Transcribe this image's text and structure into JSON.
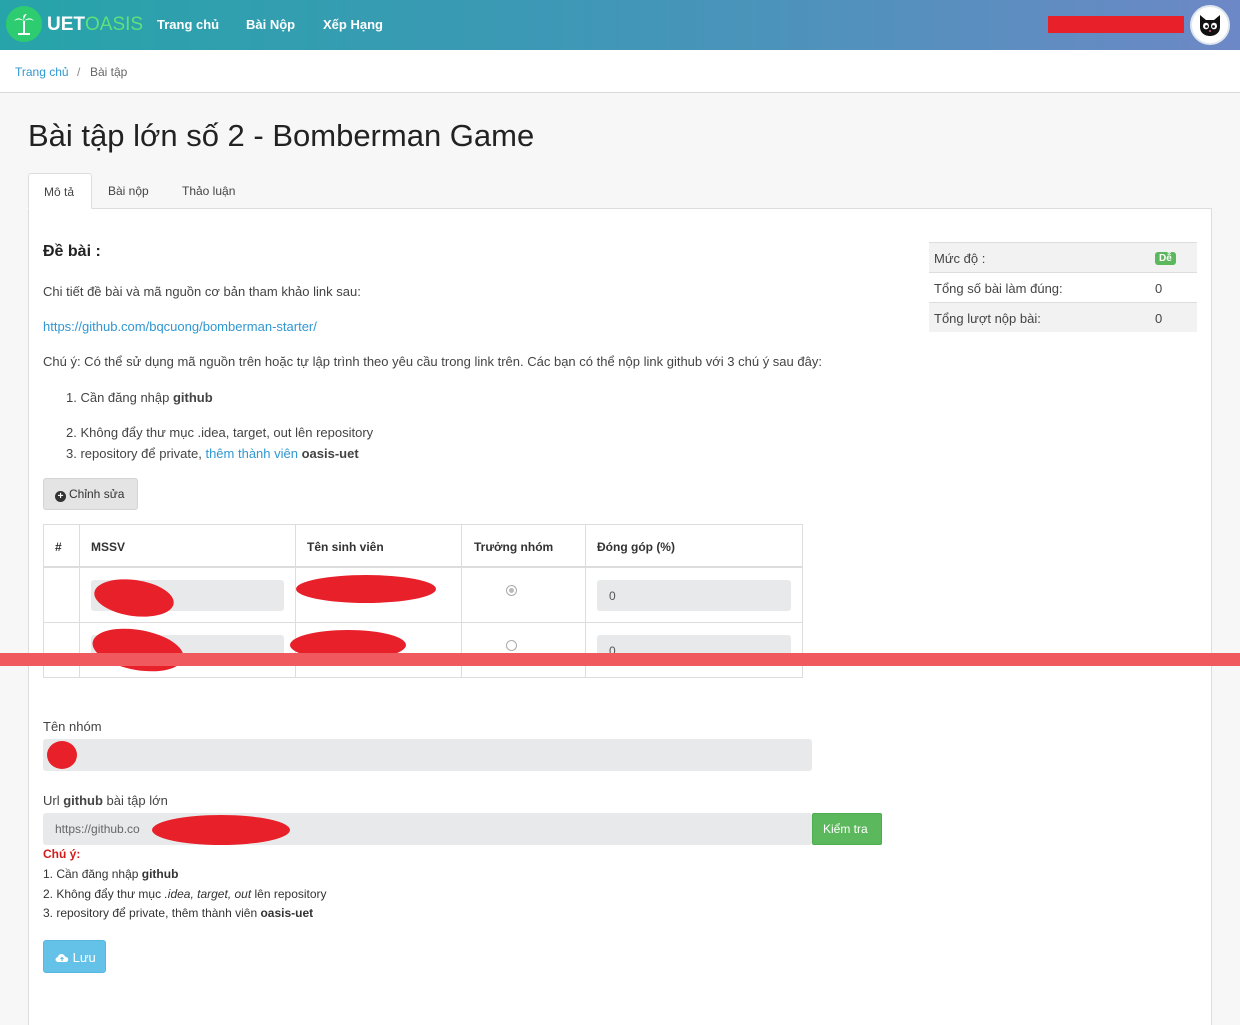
{
  "nav": {
    "logo_part1": "UET",
    "logo_part2": "OASIS",
    "links": [
      "Trang chủ",
      "Bài Nộp",
      "Xếp Hạng"
    ]
  },
  "breadcrumb": {
    "home": "Trang chủ",
    "separator": "/",
    "current": "Bài tập"
  },
  "page": {
    "title": "Bài tập lớn số 2 - Bomberman Game"
  },
  "tabs": [
    "Mô tả",
    "Bài nộp",
    "Thảo luận"
  ],
  "problem": {
    "heading": "Đề bài :",
    "intro": "Chi tiết đề bài và mã nguồn cơ bản tham khảo link sau:",
    "link": "https://github.com/bqcuong/bomberman-starter/",
    "note": "Chú ý: Có thể sử dụng mã nguồn trên hoặc tự lập trình theo yêu cầu trong link trên. Các bạn có thể nộp link github với 3 chú ý sau đây:",
    "item1_text": "1. Cần đăng nhập ",
    "item1_bold": "github",
    "item2": "2. Không đẩy thư mục .idea, target, out lên repository",
    "item3_text": "3. repository để private, ",
    "item3_link": "thêm thành viên",
    "item3_bold": "oasis-uet"
  },
  "edit_button": "Chỉnh sửa",
  "stats": {
    "level_label": "Mức độ :",
    "level_value": "Dễ",
    "correct_label": "Tổng số bài làm đúng:",
    "correct_value": "0",
    "submissions_label": "Tổng lượt nộp bài:",
    "submissions_value": "0"
  },
  "members_table": {
    "headers": [
      "#",
      "MSSV",
      "Tên sinh viên",
      "Trưởng nhóm",
      "Đóng góp (%)"
    ],
    "rows": [
      {
        "leader_selected": true,
        "contribution": "0"
      },
      {
        "leader_selected": false,
        "contribution": "0"
      }
    ]
  },
  "form": {
    "group_name_label": "Tên nhóm",
    "github_label_prefix": "Url ",
    "github_label_bold": "github",
    "github_label_suffix": " bài tập lớn",
    "github_value": "https://github.co",
    "check_button": "Kiểm tra",
    "note_title": "Chú ý:",
    "note1_text": "1. Cần đăng nhập ",
    "note1_bold": "github",
    "note2_prefix": "2. Không đẩy thư mục ",
    "note2_italic": ".idea, target, out",
    "note2_suffix": " lên repository",
    "note3_text": "3. repository để private, thêm thành viên ",
    "note3_bold": "oasis-uet",
    "save_button": "Lưu"
  },
  "colors": {
    "nav_gradient_start": "#27a4a9",
    "nav_gradient_end": "#6d88c6",
    "link": "#3097d1",
    "success": "#5cb85c",
    "info": "#64c2e8",
    "redaction": "#e8202a"
  }
}
